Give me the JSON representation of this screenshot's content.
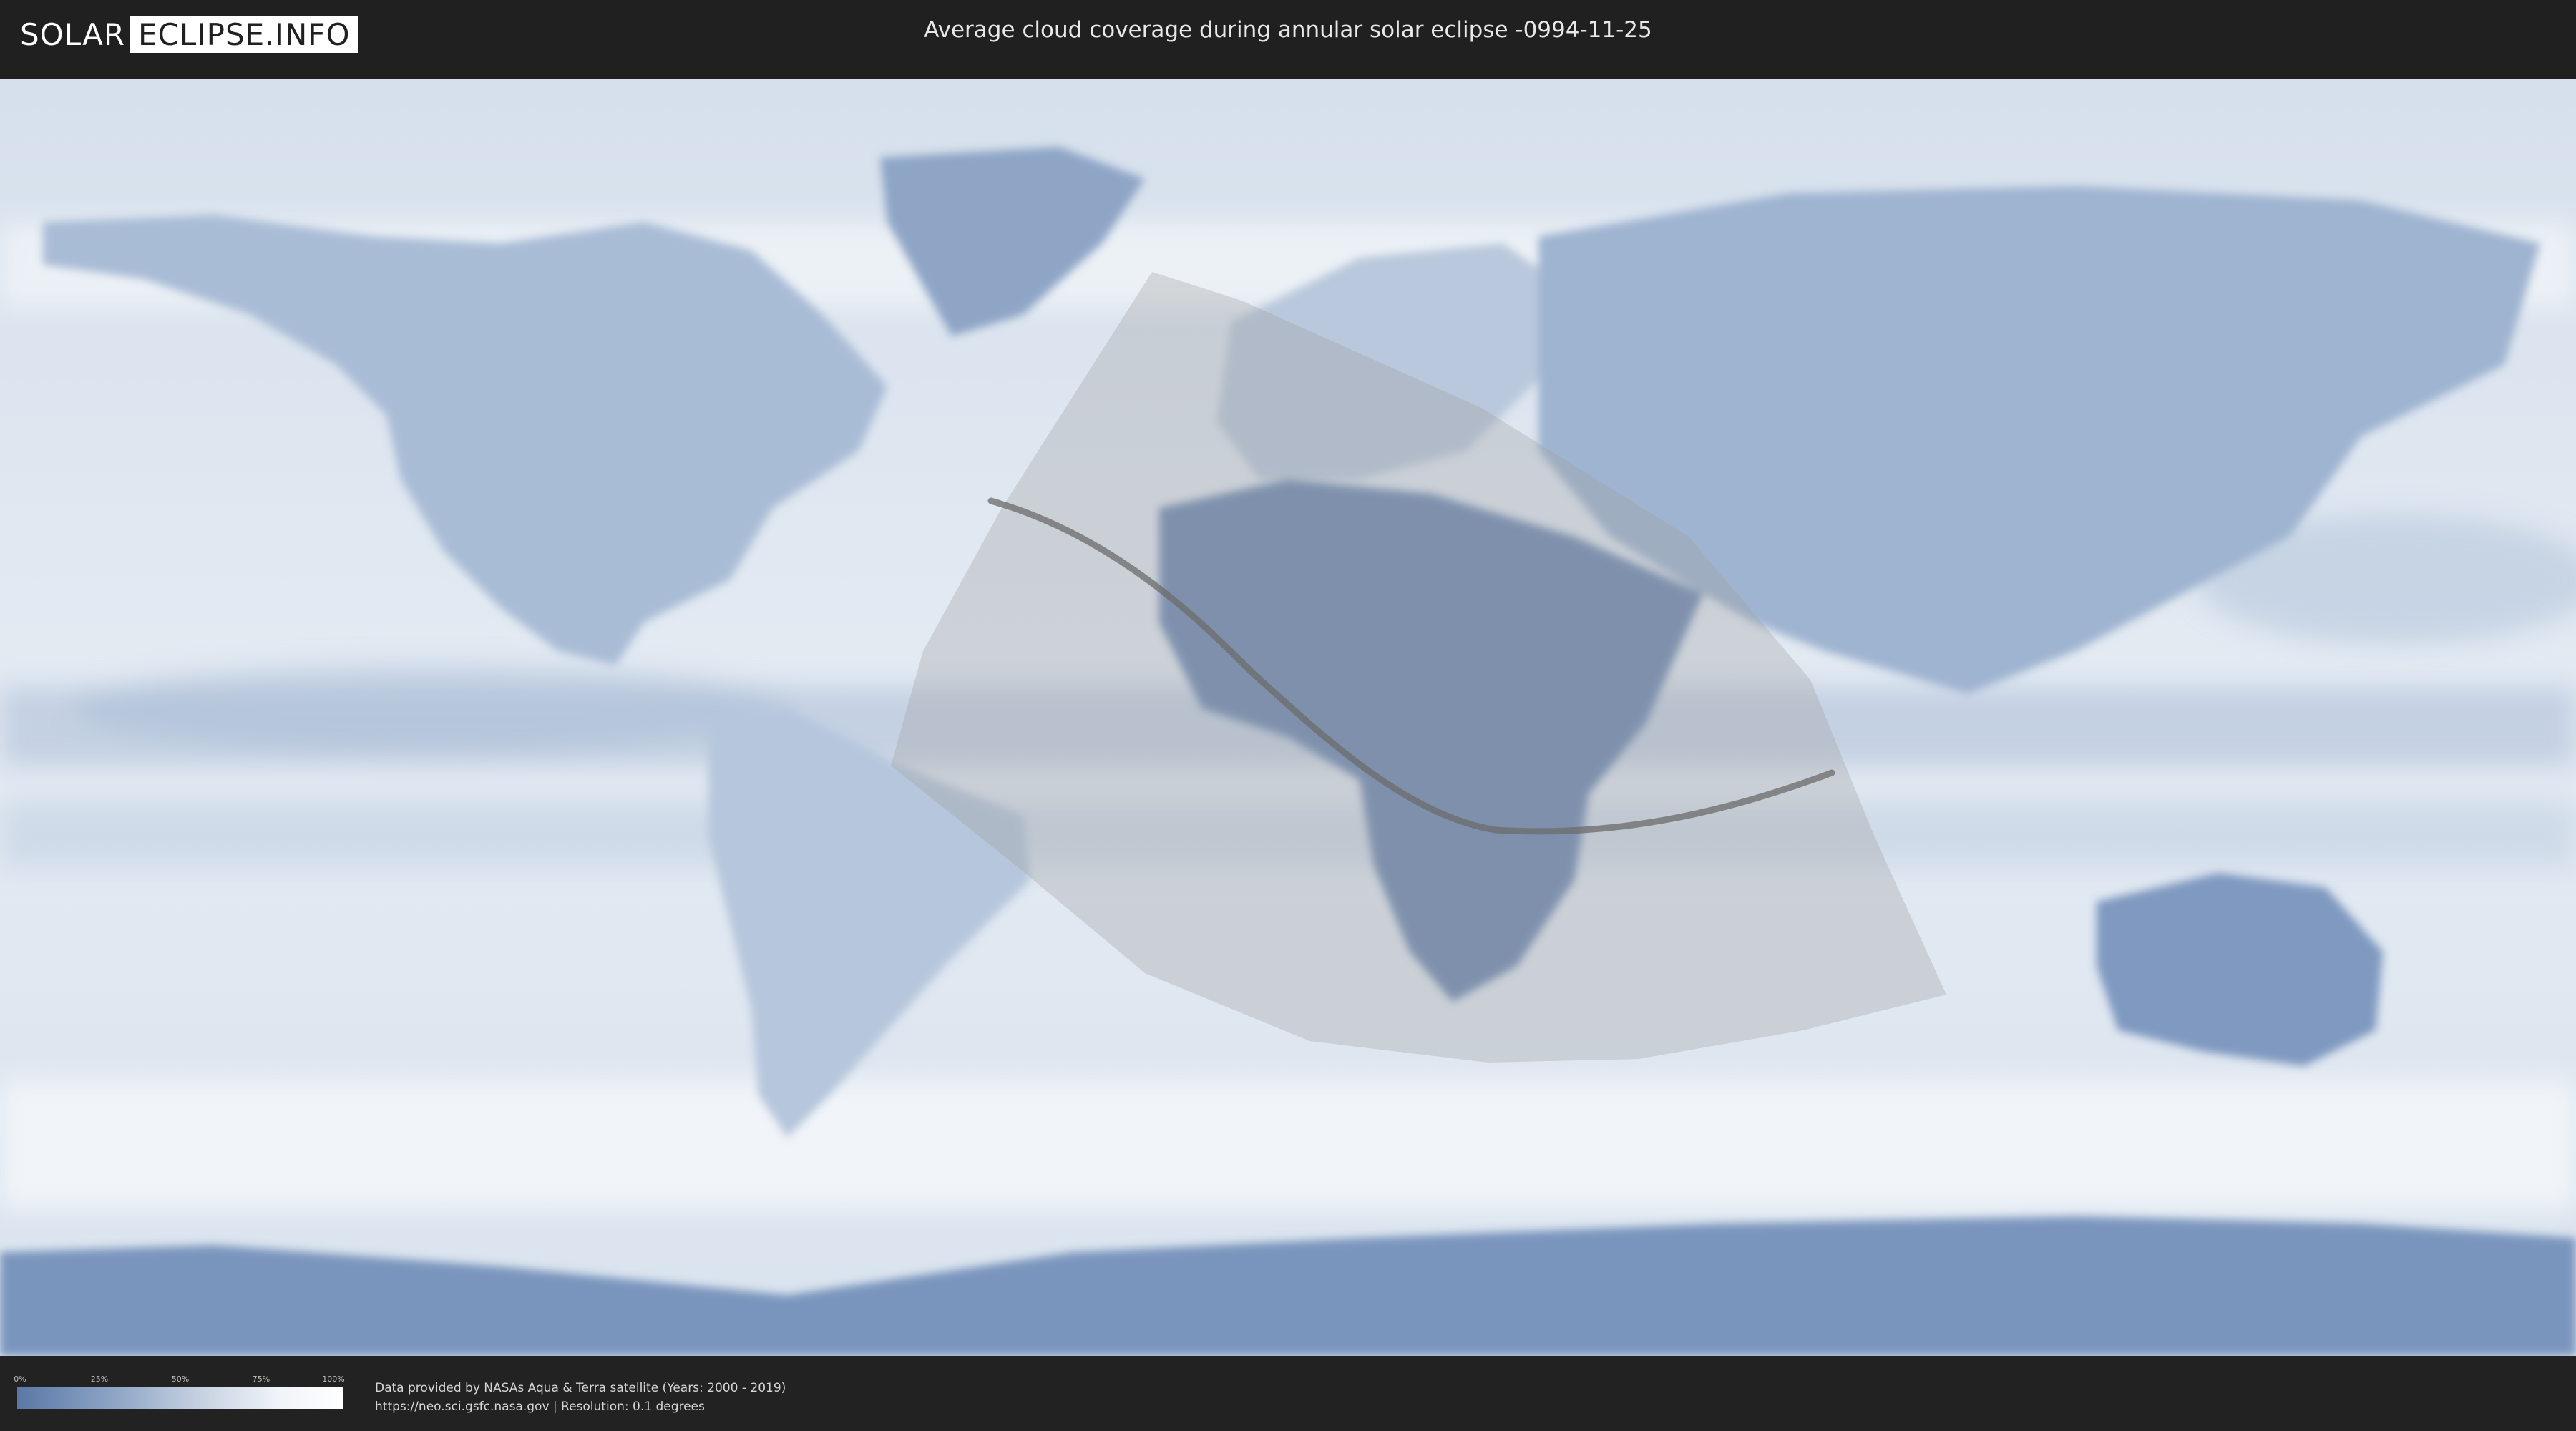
{
  "header": {
    "logo_left": "SOLAR",
    "logo_right": "ECLIPSE.INFO",
    "title": "Average cloud coverage during annular solar eclipse -0994-11-25"
  },
  "legend": {
    "ticks": [
      "0%",
      "25%",
      "50%",
      "75%",
      "100%"
    ],
    "gradient_colors": [
      "#5a78a6",
      "#8ea5c6",
      "#c4d0e0",
      "#f0f3f8",
      "#ffffff"
    ]
  },
  "credits": {
    "line1": "Data provided by NASAs Aqua & Terra satellite (Years: 2000 - 2019)",
    "line2": "https://neo.sci.gsfc.nasa.gov | Resolution: 0.1 degrees"
  },
  "colors": {
    "ocean_clear": "#e6ecf4",
    "land_clear": "#7d96bd",
    "eclipse_zone": "#a0a0a0",
    "central_line": "#6b6b6b"
  }
}
